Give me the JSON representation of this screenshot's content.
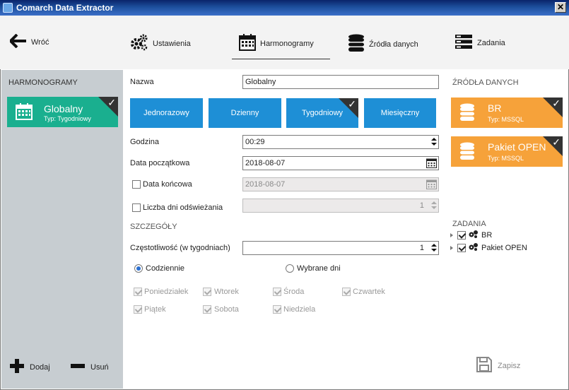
{
  "window": {
    "title": "Comarch Data Extractor",
    "close": "✕"
  },
  "toolbar": {
    "back": "Wróć",
    "settings": "Ustawienia",
    "schedules": "Harmonogramy",
    "data_sources": "Źródła danych",
    "tasks": "Zadania"
  },
  "sidebar": {
    "header": "HARMONOGRAMY",
    "items": [
      {
        "name": "Globalny",
        "type": "Typ: Tygodniowy",
        "checked": true
      }
    ],
    "add": "Dodaj",
    "remove": "Usuń"
  },
  "form": {
    "name_label": "Nazwa",
    "name_value": "Globalny",
    "freq_options": [
      "Jednorazowy",
      "Dzienny",
      "Tygodniowy",
      "Miesięczny"
    ],
    "freq_selected": "Tygodniowy",
    "time_label": "Godzina",
    "time_value": "00:29",
    "start_label": "Data początkowa",
    "start_value": "2018-08-07",
    "end_label": "Data końcowa",
    "end_value": "2018-08-07",
    "refresh_label": "Liczba dni odświeżania",
    "refresh_value": "1",
    "details_header": "SZCZEGÓŁY",
    "interval_label": "Częstotliwość (w tygodniach)",
    "interval_value": "1",
    "radio_daily": "Codziennie",
    "radio_selected_days": "Wybrane dni",
    "days": [
      "Poniedziałek",
      "Wtorek",
      "Środa",
      "Czwartek",
      "Piątek",
      "Sobota",
      "Niedziela"
    ],
    "save": "Zapisz"
  },
  "sources": {
    "header": "ŹRÓDŁA DANYCH",
    "items": [
      {
        "name": "BR",
        "type": "Typ: MSSQL"
      },
      {
        "name": "Pakiet OPEN",
        "type": "Typ: MSSQL"
      }
    ]
  },
  "tasks": {
    "header": "ZADANIA",
    "items": [
      "BR",
      "Pakiet OPEN"
    ]
  },
  "colors": {
    "schedule_card": "#1aaf8f",
    "freq_button": "#1e8fd6",
    "source_card": "#f6a23a",
    "sidebar_bg": "#c7cdd1",
    "toolbar_bg": "#f3f3f3"
  }
}
